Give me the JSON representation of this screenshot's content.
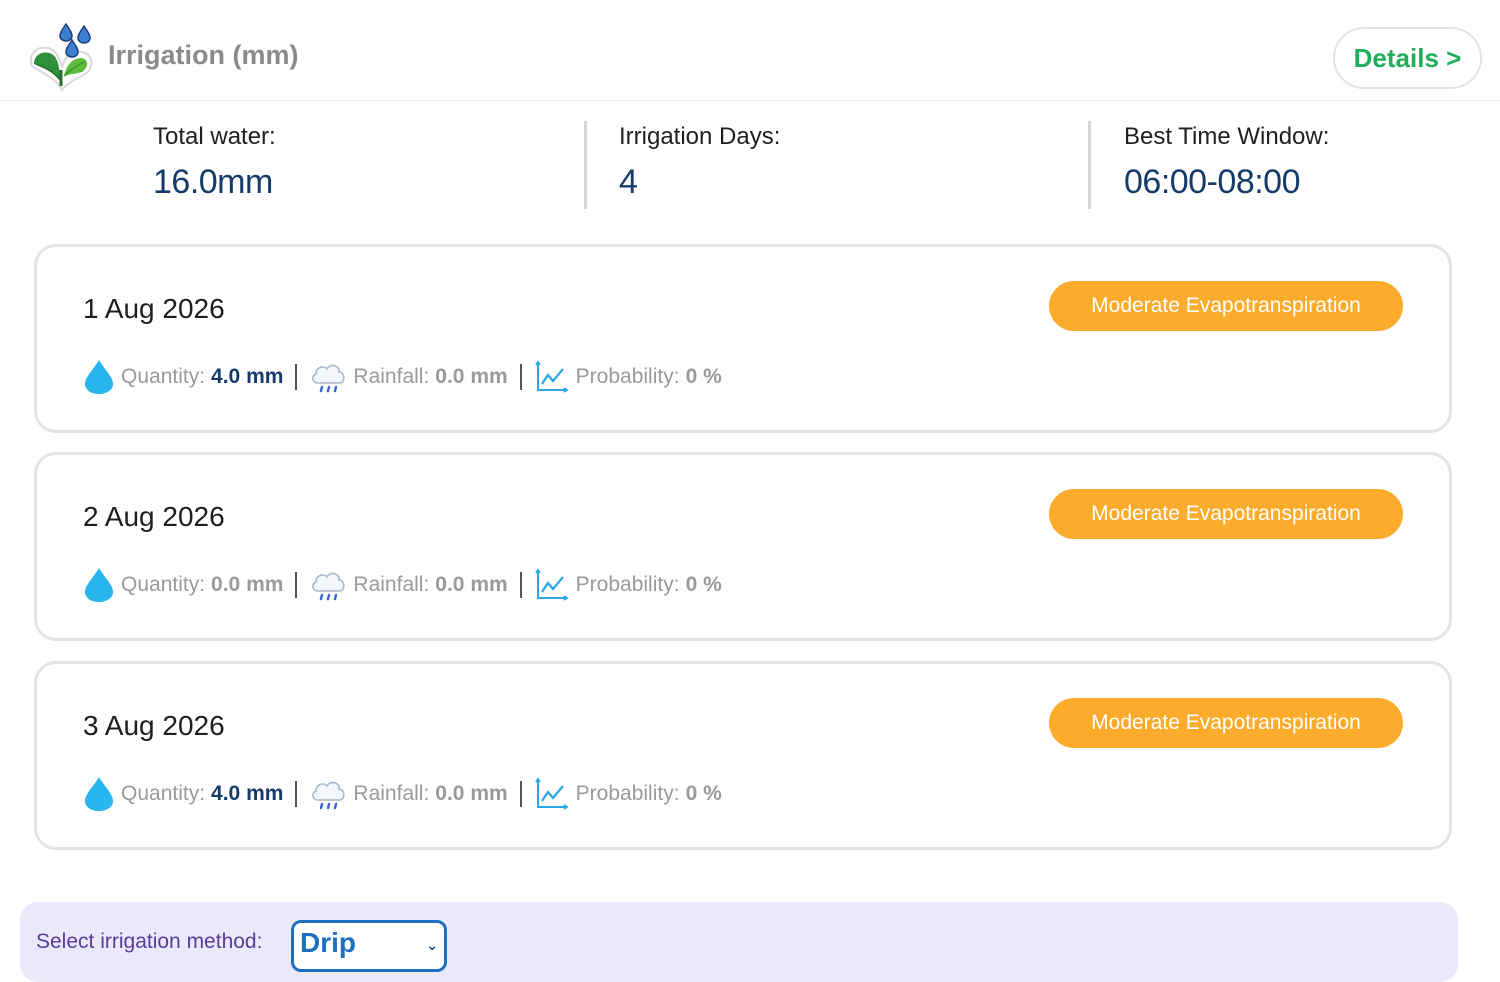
{
  "header": {
    "title": "Irrigation (mm)",
    "details_label": "Details >"
  },
  "summary": {
    "total_water_label": "Total water:",
    "total_water_value": "16.0mm",
    "irrigation_days_label": "Irrigation Days:",
    "irrigation_days_value": "4",
    "best_time_label": "Best Time Window:",
    "best_time_value": "06:00-08:00"
  },
  "days": [
    {
      "date": "1 Aug 2026",
      "badge": "Moderate Evapotranspiration",
      "quantity_label": "Quantity:",
      "quantity_value": "4.0 mm",
      "rainfall_label": "Rainfall:",
      "rainfall_value": "0.0 mm",
      "probability_label": "Probability:",
      "probability_value": "0 %"
    },
    {
      "date": "2 Aug 2026",
      "badge": "Moderate Evapotranspiration",
      "quantity_label": "Quantity:",
      "quantity_value": "0.0 mm",
      "rainfall_label": "Rainfall:",
      "rainfall_value": "0.0 mm",
      "probability_label": "Probability:",
      "probability_value": "0 %"
    },
    {
      "date": "3 Aug 2026",
      "badge": "Moderate Evapotranspiration",
      "quantity_label": "Quantity:",
      "quantity_value": "4.0 mm",
      "rainfall_label": "Rainfall:",
      "rainfall_value": "0.0 mm",
      "probability_label": "Probability:",
      "probability_value": "0 %"
    }
  ],
  "method": {
    "label": "Select irrigation method:",
    "selected": "Drip"
  },
  "icons": {
    "logo": "plant-water-drops-icon",
    "quantity": "water-drop-icon",
    "rainfall": "rain-cloud-icon",
    "probability": "line-chart-icon",
    "select": "chevron-down-icon"
  },
  "colors": {
    "details_text": "#1fae5a",
    "value_text": "#153b6b",
    "badge": "#fdab2c",
    "drop": "#29b6ee",
    "method_bg": "#e9e9fb",
    "select_border": "#1d6fc0"
  }
}
